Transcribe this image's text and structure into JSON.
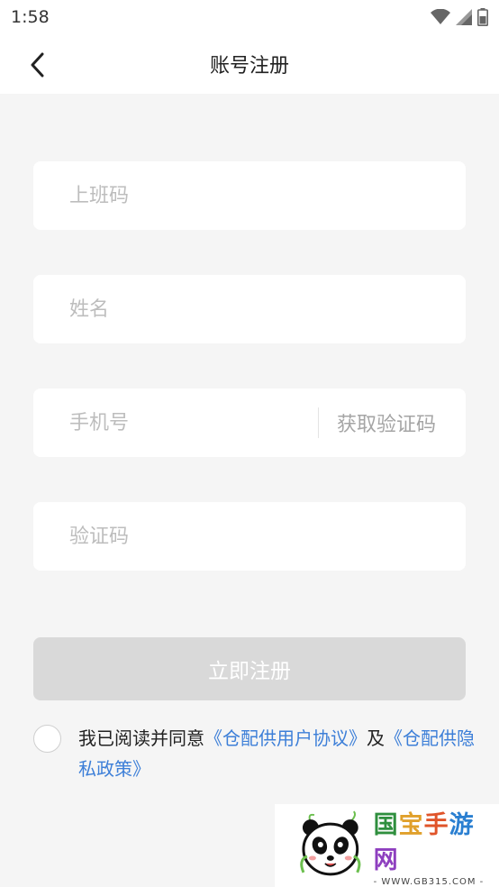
{
  "status_bar": {
    "time": "1:58",
    "icons": [
      "wifi-icon",
      "signal-icon",
      "battery-icon"
    ]
  },
  "header": {
    "title": "账号注册",
    "back_icon": "chevron-left-icon"
  },
  "form": {
    "work_code_placeholder": "上班码",
    "name_placeholder": "姓名",
    "phone_placeholder": "手机号",
    "get_code_label": "获取验证码",
    "verify_code_placeholder": "验证码",
    "submit_label": "立即注册"
  },
  "agreement": {
    "checked": false,
    "prefix": "我已阅读并同意",
    "user_agreement": "《仓配供用户协议》",
    "conjunction": "及",
    "privacy_policy": "《仓配供隐私政策》"
  },
  "watermark": {
    "title": "国宝手游网",
    "url": "- WWW.GB315.COM -"
  },
  "colors": {
    "background": "#f5f5f5",
    "link": "#3d7fd8",
    "submit_disabled": "#d9d9d9",
    "placeholder": "#bdbdbd"
  }
}
